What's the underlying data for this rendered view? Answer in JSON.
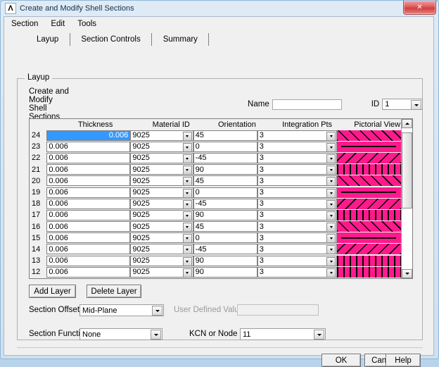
{
  "window": {
    "title": "Create and Modify Shell Sections",
    "icon": "ansys-lambda-icon",
    "close_label": "✕"
  },
  "menubar": {
    "items": [
      {
        "label": "Section"
      },
      {
        "label": "Edit"
      },
      {
        "label": "Tools"
      }
    ]
  },
  "tabs": [
    {
      "label": "Layup",
      "selected": true
    },
    {
      "label": "Section Controls",
      "selected": false
    },
    {
      "label": "Summary",
      "selected": false
    }
  ],
  "group": {
    "title": "Layup",
    "caption": "Create and Modify Shell Sections",
    "name_label": "Name",
    "name_value": "",
    "id_label": "ID",
    "id_value": "1"
  },
  "table": {
    "headers": {
      "row": "",
      "thickness": "Thickness",
      "material_id": "Material ID",
      "orientation": "Orientation",
      "integration_pts": "Integration Pts",
      "pictorial_view": "Pictorial View"
    },
    "selected_row_index": 0,
    "rows": [
      {
        "index": "24",
        "thickness": "0.006",
        "material_id": "9025",
        "orientation": "45",
        "integration_pts": "3",
        "pattern": "pic45"
      },
      {
        "index": "23",
        "thickness": "0.006",
        "material_id": "9025",
        "orientation": "0",
        "integration_pts": "3",
        "pattern": "pic0"
      },
      {
        "index": "22",
        "thickness": "0.006",
        "material_id": "9025",
        "orientation": "-45",
        "integration_pts": "3",
        "pattern": "picn45"
      },
      {
        "index": "21",
        "thickness": "0.006",
        "material_id": "9025",
        "orientation": "90",
        "integration_pts": "3",
        "pattern": "pic90"
      },
      {
        "index": "20",
        "thickness": "0.006",
        "material_id": "9025",
        "orientation": "45",
        "integration_pts": "3",
        "pattern": "pic45"
      },
      {
        "index": "19",
        "thickness": "0.006",
        "material_id": "9025",
        "orientation": "0",
        "integration_pts": "3",
        "pattern": "pic0"
      },
      {
        "index": "18",
        "thickness": "0.006",
        "material_id": "9025",
        "orientation": "-45",
        "integration_pts": "3",
        "pattern": "picn45"
      },
      {
        "index": "17",
        "thickness": "0.006",
        "material_id": "9025",
        "orientation": "90",
        "integration_pts": "3",
        "pattern": "pic90"
      },
      {
        "index": "16",
        "thickness": "0.006",
        "material_id": "9025",
        "orientation": "45",
        "integration_pts": "3",
        "pattern": "pic45"
      },
      {
        "index": "15",
        "thickness": "0.006",
        "material_id": "9025",
        "orientation": "0",
        "integration_pts": "3",
        "pattern": "pic0"
      },
      {
        "index": "14",
        "thickness": "0.006",
        "material_id": "9025",
        "orientation": "-45",
        "integration_pts": "3",
        "pattern": "picn45"
      },
      {
        "index": "13",
        "thickness": "0.006",
        "material_id": "9025",
        "orientation": "90",
        "integration_pts": "3",
        "pattern": "pic90"
      },
      {
        "index": "12",
        "thickness": "0.006",
        "material_id": "9025",
        "orientation": "90",
        "integration_pts": "3",
        "pattern": "pic90"
      }
    ]
  },
  "layer_buttons": {
    "add": "Add Layer",
    "delete": "Delete Layer"
  },
  "offset": {
    "label": "Section Offset",
    "value": "Mid-Plane",
    "user_defined_label": "User Defined Value",
    "user_defined_value": "",
    "user_defined_enabled": false
  },
  "function": {
    "label": "Section Function",
    "value": "None",
    "kcn_label": "KCN or Node",
    "kcn_value": "11"
  },
  "footer": {
    "ok": "OK",
    "cancel": "Cancel",
    "help": "Help"
  },
  "colors": {
    "selection_blue": "#3399FF",
    "pictorial_magenta": "#FF1A8C",
    "close_red": "#CF3F3F"
  }
}
